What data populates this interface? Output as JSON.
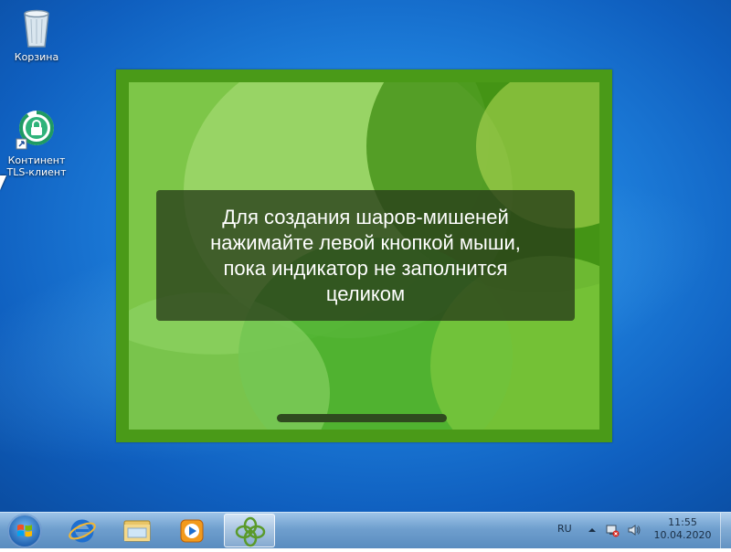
{
  "desktop": {
    "icons": [
      {
        "name": "recycle-bin",
        "label": "Корзина"
      },
      {
        "name": "tls-client",
        "label": "Континент TLS-клиент"
      }
    ]
  },
  "game": {
    "message": "Для создания шаров-мишеней нажимайте левой кнопкой мыши, пока индикатор не заполнится целиком",
    "progress": 0
  },
  "taskbar": {
    "start_label": "Start",
    "pinned": [
      "internet-explorer-icon",
      "windows-explorer-icon",
      "media-player-icon",
      "screensaver-app-icon"
    ],
    "tray": {
      "language": "RU",
      "time": "11:55",
      "date": "10.04.2020"
    }
  },
  "colors": {
    "desktop_blue": "#1c7bd8",
    "stage_green": "#4a9a18",
    "message_bg": "#283c19",
    "taskbar": "#6f9fce"
  }
}
